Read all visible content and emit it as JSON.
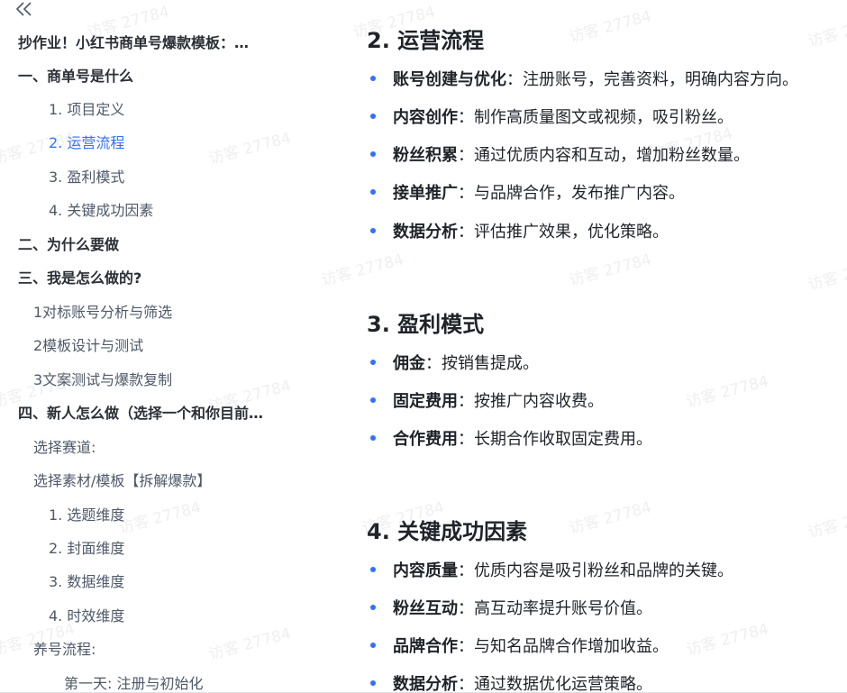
{
  "watermark_text": "访客 27784",
  "toc": {
    "items": [
      {
        "label": "抄作业！小红书商单号爆款模板：…",
        "level": "l1",
        "active": false
      },
      {
        "label": "一、商单号是什么",
        "level": "l1",
        "active": false
      },
      {
        "label": "1. 项目定义",
        "level": "l2",
        "active": false
      },
      {
        "label": "2. 运营流程",
        "level": "l2",
        "active": true
      },
      {
        "label": "3. 盈利模式",
        "level": "l2",
        "active": false
      },
      {
        "label": "4. 关键成功因素",
        "level": "l2",
        "active": false
      },
      {
        "label": "二、为什么要做",
        "level": "l1",
        "active": false
      },
      {
        "label": "三、我是怎么做的?",
        "level": "l1",
        "active": false
      },
      {
        "label": "1对标账号分析与筛选",
        "level": "l2b",
        "active": false
      },
      {
        "label": "2模板设计与测试",
        "level": "l2b",
        "active": false
      },
      {
        "label": "3文案测试与爆款复制",
        "level": "l2b",
        "active": false
      },
      {
        "label": "四、新人怎么做（选择一个和你目前…",
        "level": "l1",
        "active": false
      },
      {
        "label": "选择赛道:",
        "level": "l2b",
        "active": false
      },
      {
        "label": "选择素材/模板【拆解爆款】",
        "level": "l2b",
        "active": false
      },
      {
        "label": "1. 选题维度",
        "level": "l2",
        "active": false
      },
      {
        "label": "2. 封面维度",
        "level": "l2",
        "active": false
      },
      {
        "label": "3. 数据维度",
        "level": "l2",
        "active": false
      },
      {
        "label": "4. 时效维度",
        "level": "l2",
        "active": false
      },
      {
        "label": "养号流程:",
        "level": "l2b",
        "active": false
      },
      {
        "label": "第一天: 注册与初始化",
        "level": "l3",
        "active": false
      }
    ]
  },
  "sections": [
    {
      "heading": "2. 运营流程",
      "bullets": [
        {
          "term": "账号创建与优化",
          "text": "：注册账号，完善资料，明确内容方向。"
        },
        {
          "term": "内容创作",
          "text": "：制作高质量图文或视频，吸引粉丝。"
        },
        {
          "term": "粉丝积累",
          "text": "：通过优质内容和互动，增加粉丝数量。"
        },
        {
          "term": "接单推广",
          "text": "：与品牌合作，发布推广内容。"
        },
        {
          "term": "数据分析",
          "text": "：评估推广效果，优化策略。"
        }
      ]
    },
    {
      "heading": "3. 盈利模式",
      "bullets": [
        {
          "term": "佣金",
          "text": "：按销售提成。"
        },
        {
          "term": "固定费用",
          "text": "：按推广内容收费。"
        },
        {
          "term": "合作费用",
          "text": "：长期合作收取固定费用。"
        }
      ]
    },
    {
      "heading": "4. 关键成功因素",
      "bullets": [
        {
          "term": "内容质量",
          "text": "：优质内容是吸引粉丝和品牌的关键。"
        },
        {
          "term": "粉丝互动",
          "text": "：高互动率提升账号价值。"
        },
        {
          "term": "品牌合作",
          "text": "：与知名品牌合作增加收益。"
        },
        {
          "term": "数据分析",
          "text": "：通过数据优化运营策略。"
        }
      ]
    }
  ],
  "colors": {
    "accent": "#3370ff",
    "text": "#1f2329",
    "toc_text": "#4e5969"
  }
}
